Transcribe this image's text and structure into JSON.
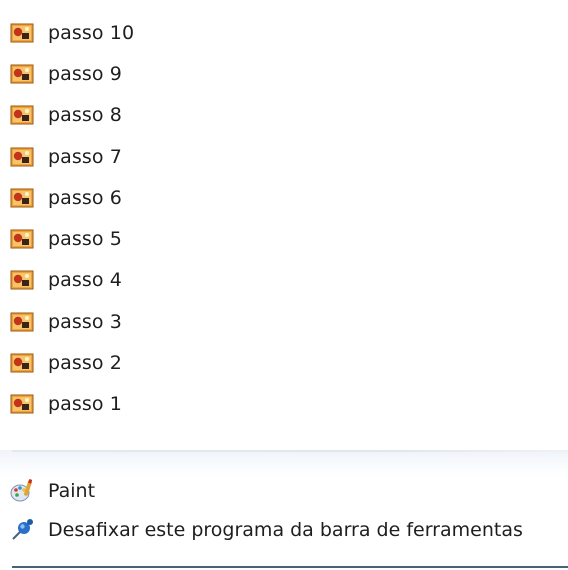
{
  "recent": {
    "items": [
      {
        "label": "passo 10",
        "icon": "image-file-icon"
      },
      {
        "label": "passo 9",
        "icon": "image-file-icon"
      },
      {
        "label": "passo 8",
        "icon": "image-file-icon"
      },
      {
        "label": "passo 7",
        "icon": "image-file-icon"
      },
      {
        "label": "passo 6",
        "icon": "image-file-icon"
      },
      {
        "label": "passo 5",
        "icon": "image-file-icon"
      },
      {
        "label": "passo 4",
        "icon": "image-file-icon"
      },
      {
        "label": "passo 3",
        "icon": "image-file-icon"
      },
      {
        "label": "passo 2",
        "icon": "image-file-icon"
      },
      {
        "label": "passo 1",
        "icon": "image-file-icon"
      }
    ]
  },
  "tasks": {
    "paint_label": "Paint",
    "unpin_label": "Desafixar este programa da barra de ferramentas"
  },
  "colors": {
    "text": "#1e1e1e",
    "icon_orange": "#e8891d",
    "icon_red": "#c4341c",
    "icon_dark": "#3a2418",
    "pin_blue": "#2a6fc9",
    "bottom_line": "#4a6278"
  }
}
